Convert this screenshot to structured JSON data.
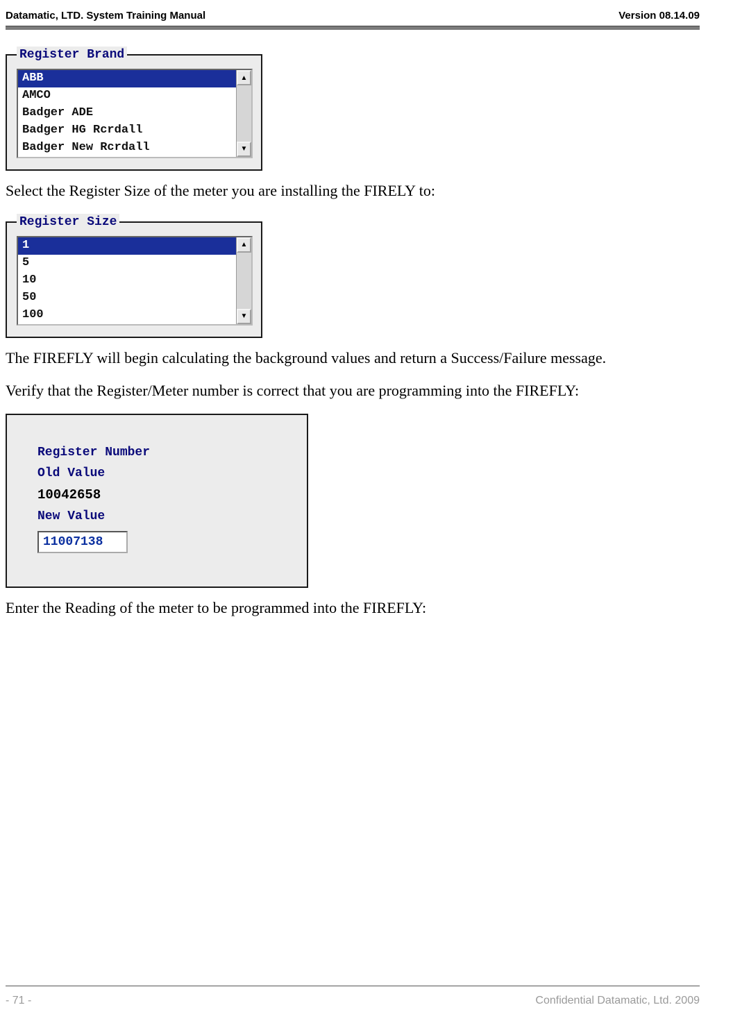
{
  "header": {
    "left": "Datamatic, LTD. System Training  Manual",
    "right": "Version 08.14.09"
  },
  "brand_box": {
    "legend": "Register Brand",
    "items": [
      "ABB",
      "AMCO",
      "Badger ADE",
      "Badger HG Rcrdall",
      "Badger New Rcrdall"
    ],
    "selected_index": 0
  },
  "para1": "Select the Register Size of the meter you are installing the FIRELY to:",
  "size_box": {
    "legend": "Register Size",
    "items": [
      "1",
      "5",
      "10",
      "50",
      "100"
    ],
    "selected_index": 0
  },
  "para2": "The FIREFLY will begin calculating the background values and return a Success/Failure message.",
  "para3": "Verify that the Register/Meter number is correct that you are programming into the FIREFLY:",
  "regnum": {
    "title": "Register Number",
    "old_label": "Old Value",
    "old_value": "10042658",
    "new_label": "New Value",
    "new_value": "11007138"
  },
  "para4": "Enter the Reading of the meter to be programmed into the FIREFLY:",
  "footer": {
    "left": "- 71 -",
    "right": "Confidential Datamatic, Ltd. 2009"
  }
}
